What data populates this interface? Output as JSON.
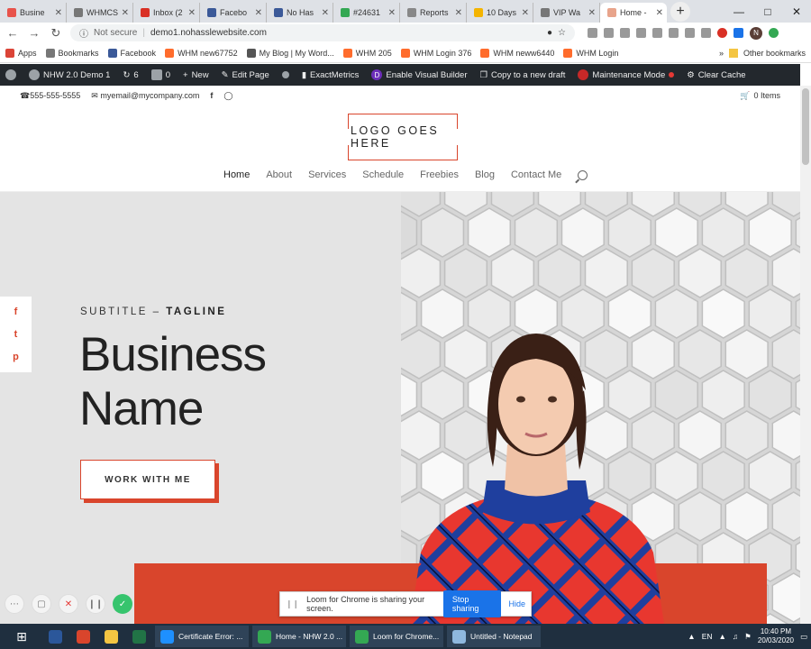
{
  "browser": {
    "tabs": [
      {
        "label": "Busine",
        "color": "#e8534b"
      },
      {
        "label": "WHMCS",
        "color": "#777777"
      },
      {
        "label": "Inbox (2",
        "color": "#d93025"
      },
      {
        "label": "Facebo",
        "color": "#3b5998"
      },
      {
        "label": "No Has",
        "color": "#3b5998"
      },
      {
        "label": "#24631",
        "color": "#34a853"
      },
      {
        "label": "Reports",
        "color": "#888888"
      },
      {
        "label": "10 Days",
        "color": "#f4b400"
      },
      {
        "label": "VIP Wa",
        "color": "#777777"
      },
      {
        "label": "Home -",
        "color": "#e8a48b",
        "active": true
      }
    ],
    "new_tab": "+",
    "url_security": "Not secure",
    "url": "demo1.nohasslewebsite.com",
    "profile_initial": "N"
  },
  "bookmarks": [
    {
      "label": "Apps",
      "color": "#db4437"
    },
    {
      "label": "Bookmarks",
      "color": "#777777"
    },
    {
      "label": "Facebook",
      "color": "#3b5998"
    },
    {
      "label": "WHM new67752",
      "color": "#ff6c2c"
    },
    {
      "label": "My Blog | My Word...",
      "color": "#555555"
    },
    {
      "label": "WHM 205",
      "color": "#ff6c2c"
    },
    {
      "label": "WHM Login 376",
      "color": "#ff6c2c"
    },
    {
      "label": "WHM neww6440",
      "color": "#ff6c2c"
    },
    {
      "label": "WHM Login",
      "color": "#ff6c2c"
    }
  ],
  "bookmarks_more": "»",
  "other_bookmarks": "Other bookmarks",
  "wpbar": {
    "site": "NHW 2.0 Demo 1",
    "updates": "6",
    "comments": "0",
    "new": "New",
    "edit": "Edit Page",
    "exactmetrics": "ExactMetrics",
    "visual_builder": "Enable Visual Builder",
    "copy_draft": "Copy to a new draft",
    "maintenance": "Maintenance Mode",
    "clear_cache": "Clear Cache",
    "divi_letter": "D"
  },
  "topstrip": {
    "phone": "555-555-5555",
    "email": "myemail@mycompany.com",
    "cart": "0 Items"
  },
  "header": {
    "logo": "LOGO GOES HERE",
    "menu": [
      "Home",
      "About",
      "Services",
      "Schedule",
      "Freebies",
      "Blog",
      "Contact Me"
    ]
  },
  "hero": {
    "subtitle_prefix": "SUBTITLE –",
    "subtitle_bold": "TAGLINE",
    "name_line1": "Business",
    "name_line2": "Name",
    "cta": "WORK WITH ME",
    "social": [
      "f",
      "t",
      "p"
    ]
  },
  "loom": {
    "message": "Loom for Chrome is sharing your screen.",
    "stop": "Stop sharing",
    "hide": "Hide"
  },
  "taskbar": {
    "items": [
      {
        "label": "Certificate Error: ...",
        "color": "#1e90ff"
      },
      {
        "label": "Home - NHW 2.0 ...",
        "color": "#34a853"
      },
      {
        "label": "Loom for Chrome...",
        "color": "#34a853"
      },
      {
        "label": "Untitled - Notepad",
        "color": "#8fb8de"
      }
    ],
    "lang": "EN",
    "time": "10:40 PM",
    "date": "20/03/2020"
  }
}
